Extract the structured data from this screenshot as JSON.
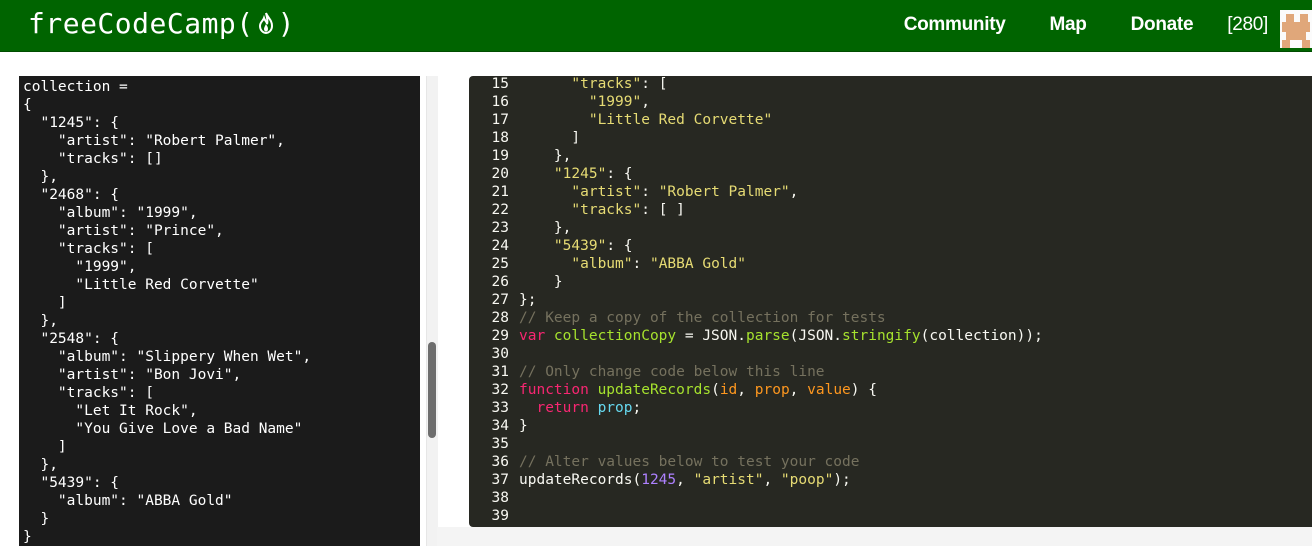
{
  "navbar": {
    "brand_prefix": "freeCodeCamp(",
    "brand_suffix": ")",
    "links": [
      "Community",
      "Map",
      "Donate"
    ],
    "points": "[280]",
    "colors": {
      "background": "#006400",
      "text": "#ffffff"
    }
  },
  "output": {
    "lines": [
      "collection =",
      "{",
      "  \"1245\": {",
      "    \"artist\": \"Robert Palmer\",",
      "    \"tracks\": []",
      "  },",
      "  \"2468\": {",
      "    \"album\": \"1999\",",
      "    \"artist\": \"Prince\",",
      "    \"tracks\": [",
      "      \"1999\",",
      "      \"Little Red Corvette\"",
      "    ]",
      "  },",
      "  \"2548\": {",
      "    \"album\": \"Slippery When Wet\",",
      "    \"artist\": \"Bon Jovi\",",
      "    \"tracks\": [",
      "      \"Let It Rock\",",
      "      \"You Give Love a Bad Name\"",
      "    ]",
      "  },",
      "  \"5439\": {",
      "    \"album\": \"ABBA Gold\"",
      "  }",
      "}"
    ]
  },
  "editor": {
    "theme_colors": {
      "background": "#272822",
      "string": "#e6db74",
      "comment": "#75715e",
      "keyword": "#f92672",
      "function": "#a6e22e",
      "number": "#ae81ff",
      "parameter": "#fd971f",
      "builtin": "#66d9ef"
    },
    "lines": [
      {
        "num": "15",
        "tokens": [
          [
            "pl",
            "      "
          ],
          [
            "str",
            "\"tracks\""
          ],
          [
            "pl",
            ": ["
          ]
        ]
      },
      {
        "num": "16",
        "tokens": [
          [
            "pl",
            "        "
          ],
          [
            "str",
            "\"1999\""
          ],
          [
            "pl",
            ","
          ]
        ]
      },
      {
        "num": "17",
        "tokens": [
          [
            "pl",
            "        "
          ],
          [
            "str",
            "\"Little Red Corvette\""
          ]
        ]
      },
      {
        "num": "18",
        "tokens": [
          [
            "pl",
            "      ]"
          ]
        ]
      },
      {
        "num": "19",
        "tokens": [
          [
            "pl",
            "    },"
          ]
        ]
      },
      {
        "num": "20",
        "tokens": [
          [
            "pl",
            "    "
          ],
          [
            "str",
            "\"1245\""
          ],
          [
            "pl",
            ": {"
          ]
        ]
      },
      {
        "num": "21",
        "tokens": [
          [
            "pl",
            "      "
          ],
          [
            "str",
            "\"artist\""
          ],
          [
            "pl",
            ": "
          ],
          [
            "str",
            "\"Robert Palmer\""
          ],
          [
            "pl",
            ","
          ]
        ]
      },
      {
        "num": "22",
        "tokens": [
          [
            "pl",
            "      "
          ],
          [
            "str",
            "\"tracks\""
          ],
          [
            "pl",
            ": [ ]"
          ]
        ]
      },
      {
        "num": "23",
        "tokens": [
          [
            "pl",
            "    },"
          ]
        ]
      },
      {
        "num": "24",
        "tokens": [
          [
            "pl",
            "    "
          ],
          [
            "str",
            "\"5439\""
          ],
          [
            "pl",
            ": {"
          ]
        ]
      },
      {
        "num": "25",
        "tokens": [
          [
            "pl",
            "      "
          ],
          [
            "str",
            "\"album\""
          ],
          [
            "pl",
            ": "
          ],
          [
            "str",
            "\"ABBA Gold\""
          ]
        ]
      },
      {
        "num": "26",
        "tokens": [
          [
            "pl",
            "    }"
          ]
        ]
      },
      {
        "num": "27",
        "tokens": [
          [
            "pl",
            "};"
          ]
        ]
      },
      {
        "num": "28",
        "tokens": [
          [
            "cmt",
            "// Keep a copy of the collection for tests"
          ]
        ]
      },
      {
        "num": "29",
        "tokens": [
          [
            "kw",
            "var "
          ],
          [
            "var",
            "collectionCopy"
          ],
          [
            "pl",
            " = JSON."
          ],
          [
            "fn",
            "parse"
          ],
          [
            "pl",
            "(JSON."
          ],
          [
            "fn",
            "stringify"
          ],
          [
            "pl",
            "(collection));"
          ]
        ]
      },
      {
        "num": "30",
        "tokens": [
          [
            "pl",
            ""
          ]
        ]
      },
      {
        "num": "31",
        "tokens": [
          [
            "cmt",
            "// Only change code below this line"
          ]
        ]
      },
      {
        "num": "32",
        "tokens": [
          [
            "kw",
            "function "
          ],
          [
            "fn",
            "updateRecords"
          ],
          [
            "pl",
            "("
          ],
          [
            "prm",
            "id"
          ],
          [
            "pl",
            ", "
          ],
          [
            "prm",
            "prop"
          ],
          [
            "pl",
            ", "
          ],
          [
            "prm",
            "value"
          ],
          [
            "pl",
            ") {"
          ]
        ]
      },
      {
        "num": "33",
        "tokens": [
          [
            "pl",
            "  "
          ],
          [
            "kw",
            "return "
          ],
          [
            "bi",
            "prop"
          ],
          [
            "pl",
            ";"
          ]
        ]
      },
      {
        "num": "34",
        "tokens": [
          [
            "pl",
            "}"
          ]
        ]
      },
      {
        "num": "35",
        "tokens": [
          [
            "pl",
            ""
          ]
        ]
      },
      {
        "num": "36",
        "tokens": [
          [
            "cmt",
            "// Alter values below to test your code"
          ]
        ]
      },
      {
        "num": "37",
        "tokens": [
          [
            "pl",
            "updateRecords("
          ],
          [
            "num",
            "1245"
          ],
          [
            "pl",
            ", "
          ],
          [
            "str",
            "\"artist\""
          ],
          [
            "pl",
            ", "
          ],
          [
            "str",
            "\"poop\""
          ],
          [
            "pl",
            ");"
          ]
        ]
      },
      {
        "num": "38",
        "tokens": [
          [
            "pl",
            ""
          ]
        ]
      },
      {
        "num": "39",
        "tokens": [
          [
            "pl",
            ""
          ]
        ]
      }
    ]
  }
}
